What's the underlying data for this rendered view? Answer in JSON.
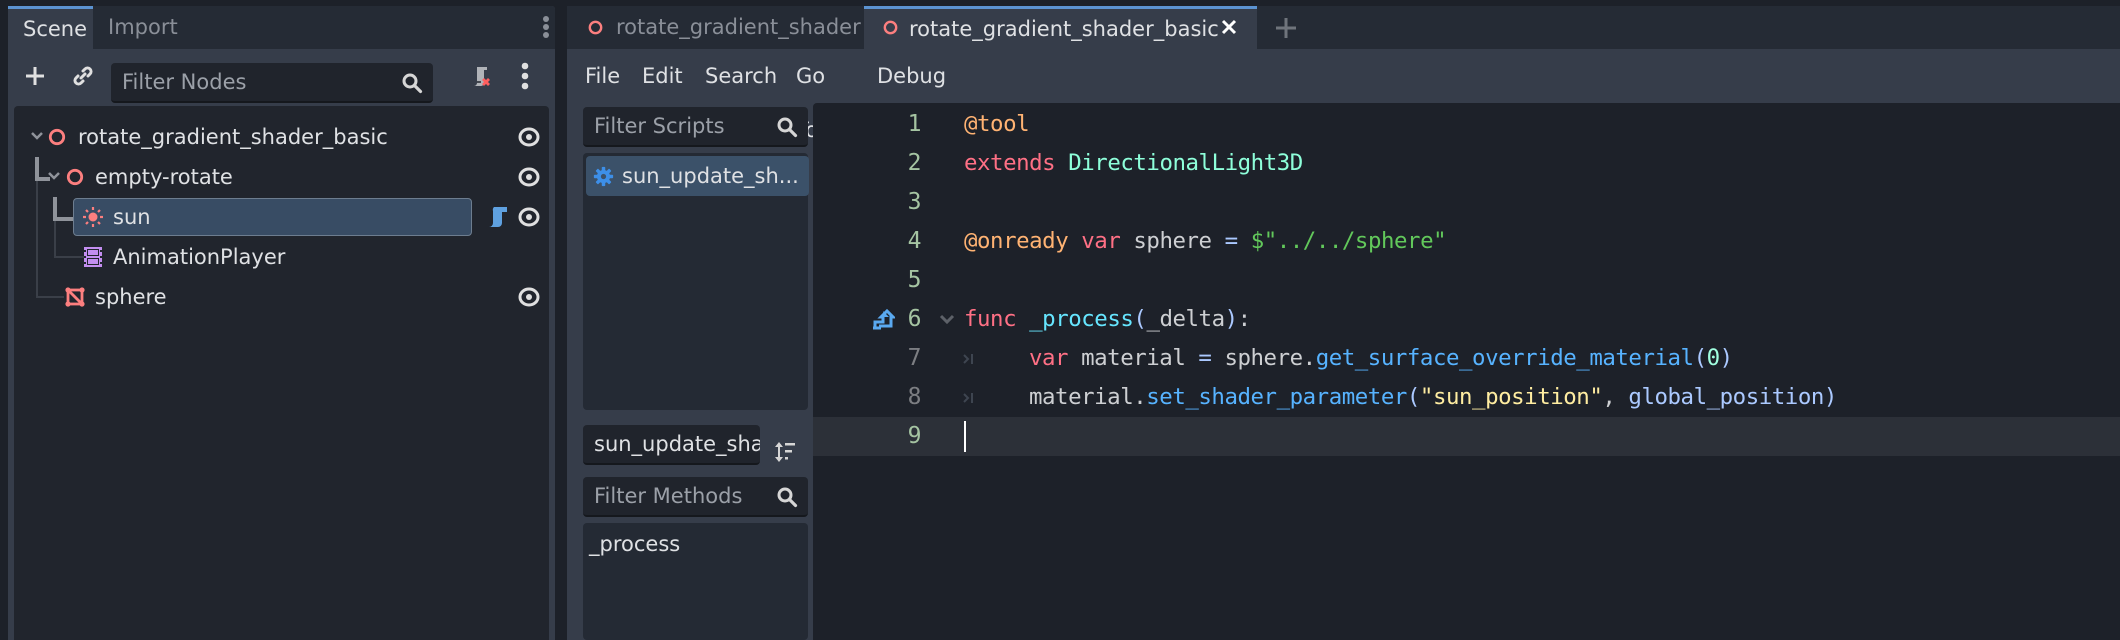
{
  "scene_dock": {
    "tabs": [
      {
        "label": "Scene",
        "active": true
      },
      {
        "label": "Import",
        "active": false
      }
    ],
    "filter_placeholder": "Filter Nodes",
    "toolbar_icons": [
      "add-node-icon",
      "link-icon",
      "search-icon",
      "script-remove-icon",
      "more-vertical-icon"
    ],
    "tree": [
      {
        "name": "rotate_gradient_shader_basic",
        "icon": "node3d-icon",
        "depth": 0,
        "expanded": true,
        "visible": true,
        "selected": false,
        "script": false
      },
      {
        "name": "empty-rotate",
        "icon": "node3d-icon",
        "depth": 1,
        "expanded": true,
        "visible": true,
        "selected": false,
        "script": false
      },
      {
        "name": "sun",
        "icon": "directional-light-icon",
        "depth": 2,
        "expanded": false,
        "visible": true,
        "selected": true,
        "script": true
      },
      {
        "name": "AnimationPlayer",
        "icon": "animation-player-icon",
        "depth": 2,
        "expanded": false,
        "visible": null,
        "selected": false,
        "script": false
      },
      {
        "name": "sphere",
        "icon": "mesh-instance-icon",
        "depth": 1,
        "expanded": false,
        "visible": true,
        "selected": false,
        "script": false
      }
    ]
  },
  "editor": {
    "tabs": [
      {
        "label": "rotate_gradient_shader",
        "active": false
      },
      {
        "label": "rotate_gradient_shader_basic",
        "active": true
      }
    ],
    "menu": [
      "File",
      "Edit",
      "Search",
      "Go To",
      "Debug"
    ],
    "scripts_filter_placeholder": "Filter Scripts",
    "scripts": [
      {
        "label": "sun_update_sh...",
        "selected": true,
        "icon": "gear-icon"
      }
    ],
    "current_script_name": "sun_update_shac",
    "methods_filter_placeholder": "Filter Methods",
    "methods": [
      "_process"
    ],
    "code": {
      "current_line": 9,
      "lines": [
        {
          "n": "1",
          "tokens": [
            {
              "t": "@tool",
              "c": "anno"
            }
          ]
        },
        {
          "n": "2",
          "tokens": [
            {
              "t": "extends",
              "c": "kw"
            },
            {
              "t": " ",
              "c": "text"
            },
            {
              "t": "DirectionalLight3D",
              "c": "type"
            }
          ]
        },
        {
          "n": "3",
          "tokens": []
        },
        {
          "n": "4",
          "tokens": [
            {
              "t": "@onready",
              "c": "anno"
            },
            {
              "t": " ",
              "c": "text"
            },
            {
              "t": "var",
              "c": "kw"
            },
            {
              "t": " sphere ",
              "c": "text"
            },
            {
              "t": "=",
              "c": "sym"
            },
            {
              "t": " ",
              "c": "text"
            },
            {
              "t": "$\"../../sphere\"",
              "c": "str"
            }
          ]
        },
        {
          "n": "5",
          "tokens": []
        },
        {
          "n": "6",
          "tokens": [
            {
              "t": "func",
              "c": "kw"
            },
            {
              "t": " ",
              "c": "text"
            },
            {
              "t": "_process",
              "c": "fdef"
            },
            {
              "t": "(",
              "c": "sym"
            },
            {
              "t": "_delta",
              "c": "text"
            },
            {
              "t": ")",
              "c": "sym"
            },
            {
              "t": ":",
              "c": "text"
            }
          ]
        },
        {
          "n": "7",
          "tokens": [
            {
              "t": "var",
              "c": "kw"
            },
            {
              "t": " material ",
              "c": "text"
            },
            {
              "t": "=",
              "c": "sym"
            },
            {
              "t": " sphere.",
              "c": "text"
            },
            {
              "t": "get_surface_override_material",
              "c": "func"
            },
            {
              "t": "(",
              "c": "sym"
            },
            {
              "t": "0",
              "c": "num"
            },
            {
              "t": ")",
              "c": "sym"
            }
          ]
        },
        {
          "n": "8",
          "tokens": [
            {
              "t": "material.",
              "c": "text"
            },
            {
              "t": "set_shader_parameter",
              "c": "func"
            },
            {
              "t": "(",
              "c": "sym"
            },
            {
              "t": "\"sun_position\"",
              "c": "strlit"
            },
            {
              "t": ", ",
              "c": "text"
            },
            {
              "t": "global_position",
              "c": "sym"
            },
            {
              "t": ")",
              "c": "sym"
            }
          ]
        },
        {
          "n": "9",
          "tokens": []
        }
      ]
    }
  }
}
